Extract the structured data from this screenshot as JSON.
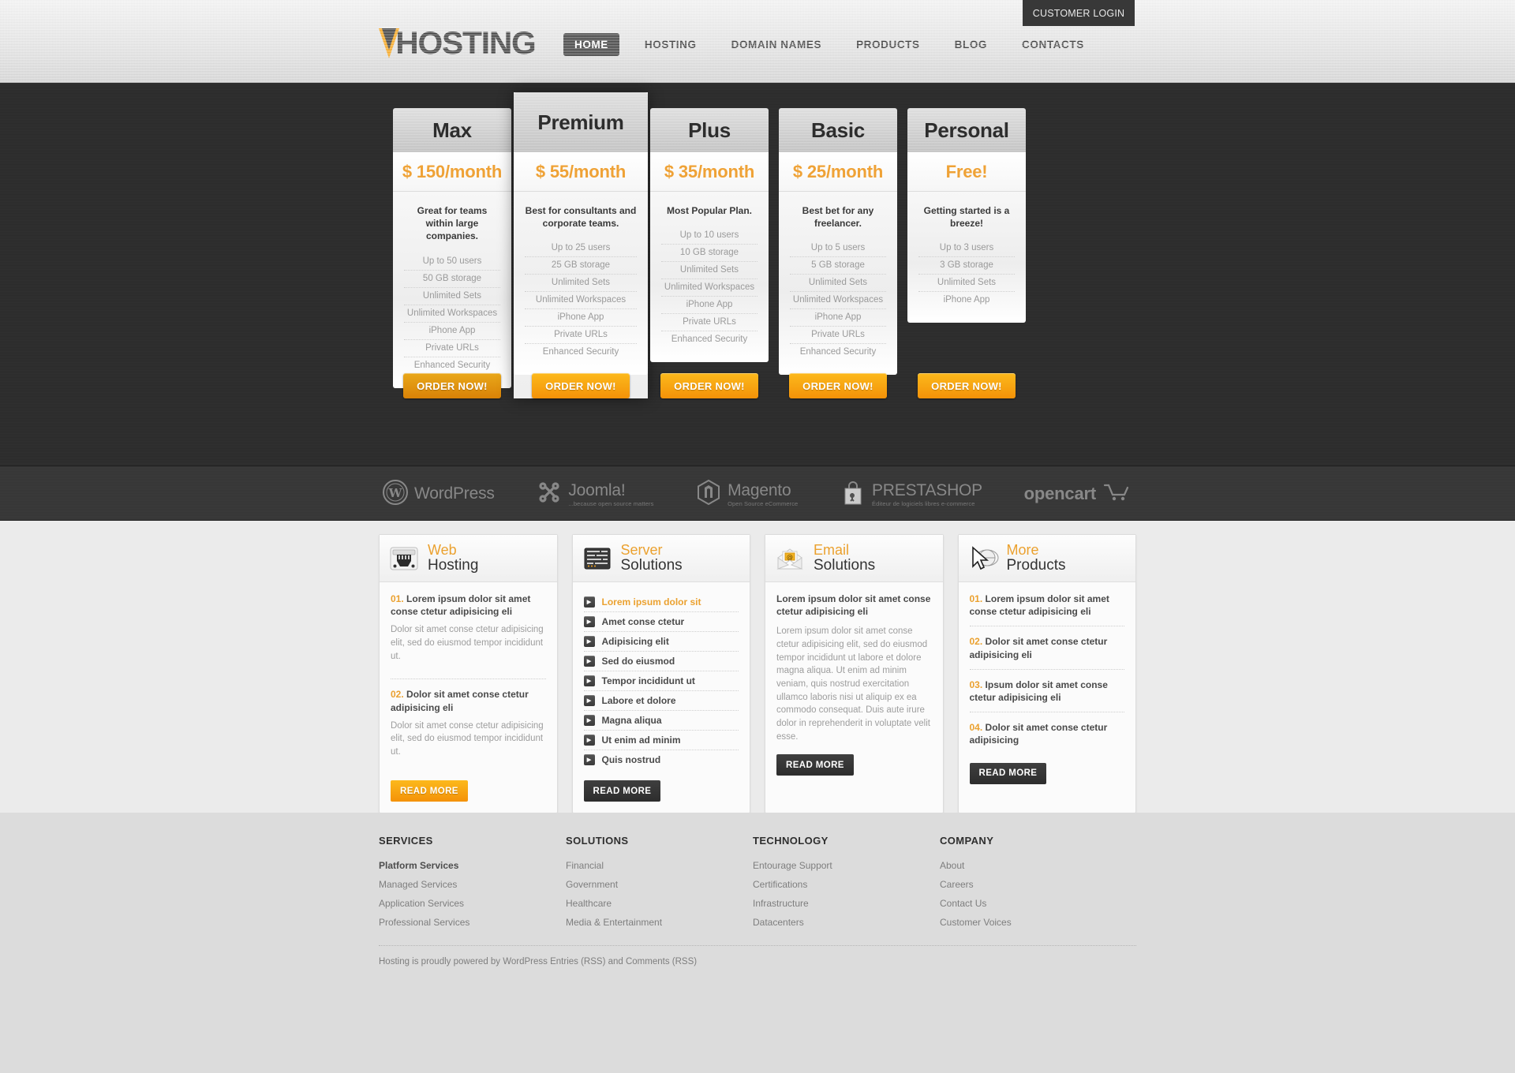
{
  "header": {
    "login_label": "CUSTOMER LOGIN",
    "logo_text": "HOSTING",
    "nav": [
      {
        "label": "HOME",
        "active": true
      },
      {
        "label": "HOSTING",
        "active": false
      },
      {
        "label": "DOMAIN NAMES",
        "active": false
      },
      {
        "label": "PRODUCTS",
        "active": false
      },
      {
        "label": "BLOG",
        "active": false
      },
      {
        "label": "CONTACTS",
        "active": false
      }
    ]
  },
  "pricing": {
    "order_label": "ORDER NOW!",
    "plans": [
      {
        "name": "Max",
        "price": "$ 150/month",
        "desc": "Great for teams within large companies.",
        "featured": false,
        "features": [
          "Up to 50 users",
          "50 GB storage",
          "Unlimited Sets",
          "Unlimited Workspaces",
          "iPhone App",
          "Private URLs",
          "Enhanced Security"
        ]
      },
      {
        "name": "Premium",
        "price": "$ 55/month",
        "desc": "Best for consultants and corporate teams.",
        "featured": true,
        "features": [
          "Up to 25 users",
          "25 GB storage",
          "Unlimited Sets",
          "Unlimited Workspaces",
          "iPhone App",
          "Private URLs",
          "Enhanced Security"
        ]
      },
      {
        "name": "Plus",
        "price": "$ 35/month",
        "desc": "Most Popular Plan.",
        "featured": false,
        "features": [
          "Up to 10 users",
          "10 GB storage",
          "Unlimited Sets",
          "Unlimited Workspaces",
          "iPhone App",
          "Private URLs",
          "Enhanced Security"
        ]
      },
      {
        "name": "Basic",
        "price": "$ 25/month",
        "desc": "Best bet for any freelancer.",
        "featured": false,
        "features": [
          "Up to 5 users",
          "5 GB storage",
          "Unlimited Sets",
          "Unlimited Workspaces",
          "iPhone App",
          "Private URLs",
          "Enhanced Security"
        ]
      },
      {
        "name": "Personal",
        "price": "Free!",
        "desc": "Getting started is a breeze!",
        "featured": false,
        "features": [
          "Up to 3 users",
          "3 GB storage",
          "Unlimited Sets",
          "iPhone App"
        ]
      }
    ]
  },
  "cms": [
    {
      "name": "WordPress",
      "icon": "wordpress-icon",
      "sub": ""
    },
    {
      "name": "Joomla!",
      "icon": "joomla-icon",
      "sub": "...because open source matters"
    },
    {
      "name": "Magento",
      "icon": "magento-icon",
      "sub": "Open Source eCommerce"
    },
    {
      "name": "PRESTASHOP",
      "icon": "prestashop-icon",
      "sub": "Éditeur de logiciels libres e-commerce"
    },
    {
      "name": "opencart",
      "icon": "opencart-icon",
      "sub": ""
    }
  ],
  "features": {
    "web_hosting": {
      "icon": "ethernet-port-icon",
      "title_top": "Web",
      "title_bottom": "Hosting",
      "items": [
        {
          "num": "01.",
          "heading": "Lorem ipsum dolor sit amet conse ctetur adipisicing eli",
          "text": "Dolor sit amet conse ctetur adipisicing elit, sed do eiusmod tempor incididunt ut."
        },
        {
          "num": "02.",
          "heading": "Dolor sit amet conse ctetur adipisicing eli",
          "text": "Dolor sit amet conse ctetur adipisicing elit, sed do eiusmod tempor incididunt ut."
        }
      ],
      "read_more": "READ MORE"
    },
    "server_solutions": {
      "icon": "server-rack-icon",
      "title_top": "Server",
      "title_bottom": "Solutions",
      "links": [
        {
          "label": "Lorem ipsum dolor sit",
          "highlighted": true
        },
        {
          "label": "Amet conse ctetur",
          "highlighted": false
        },
        {
          "label": "Adipisicing elit",
          "highlighted": false
        },
        {
          "label": "Sed do eiusmod",
          "highlighted": false
        },
        {
          "label": "Tempor incididunt ut",
          "highlighted": false
        },
        {
          "label": "Labore et dolore",
          "highlighted": false
        },
        {
          "label": "Magna aliqua",
          "highlighted": false
        },
        {
          "label": "Ut enim ad minim",
          "highlighted": false
        },
        {
          "label": "Quis nostrud",
          "highlighted": false
        }
      ],
      "read_more": "READ MORE"
    },
    "email_solutions": {
      "icon": "envelope-icon",
      "title_top": "Email",
      "title_bottom": "Solutions",
      "heading": "Lorem ipsum dolor sit amet conse ctetur adipisicing eli",
      "paragraph": "Lorem ipsum dolor sit amet conse ctetur adipisicing elit, sed do eiusmod tempor incididunt ut labore et dolore magna aliqua. Ut enim ad minim veniam, quis nostrud exercitation ullamco laboris nisi ut aliquip ex ea commodo consequat. Duis aute irure dolor in reprehenderit in voluptate velit esse.",
      "read_more": "READ MORE"
    },
    "more_products": {
      "icon": "cursor-globe-icon",
      "title_top": "More",
      "title_bottom": "Products",
      "items": [
        {
          "num": "01.",
          "heading": "Lorem ipsum dolor sit amet conse ctetur adipisicing eli"
        },
        {
          "num": "02.",
          "heading": "Dolor sit amet conse ctetur adipisicing eli"
        },
        {
          "num": "03.",
          "heading": "Ipsum dolor sit amet conse ctetur adipisicing eli"
        },
        {
          "num": "04.",
          "heading": "Dolor sit amet conse ctetur adipisicing"
        }
      ],
      "read_more": "READ MORE"
    }
  },
  "footer": {
    "columns": [
      {
        "heading": "SERVICES",
        "links": [
          {
            "label": "Platform Services",
            "bold": true
          },
          {
            "label": "Managed Services",
            "bold": false
          },
          {
            "label": "Application Services",
            "bold": false
          },
          {
            "label": "Professional Services",
            "bold": false
          }
        ]
      },
      {
        "heading": "SOLUTIONS",
        "links": [
          {
            "label": "Financial",
            "bold": false
          },
          {
            "label": "Government",
            "bold": false
          },
          {
            "label": "Healthcare",
            "bold": false
          },
          {
            "label": "Media & Entertainment",
            "bold": false
          }
        ]
      },
      {
        "heading": "TECHNOLOGY",
        "links": [
          {
            "label": "Entourage Support",
            "bold": false
          },
          {
            "label": "Certifications",
            "bold": false
          },
          {
            "label": "Infrastructure",
            "bold": false
          },
          {
            "label": "Datacenters",
            "bold": false
          }
        ]
      },
      {
        "heading": "COMPANY",
        "links": [
          {
            "label": "About",
            "bold": false
          },
          {
            "label": "Careers",
            "bold": false
          },
          {
            "label": "Contact Us",
            "bold": false
          },
          {
            "label": "Customer Voices",
            "bold": false
          }
        ]
      }
    ],
    "copyright": "Hosting is proudly powered by WordPress  Entries (RSS) and Comments (RSS)"
  },
  "colors": {
    "accent_orange": "#efa236",
    "dark_bg": "#2b2b2b",
    "strip_bg": "#363636",
    "footer_bg": "#dcdcdc"
  }
}
